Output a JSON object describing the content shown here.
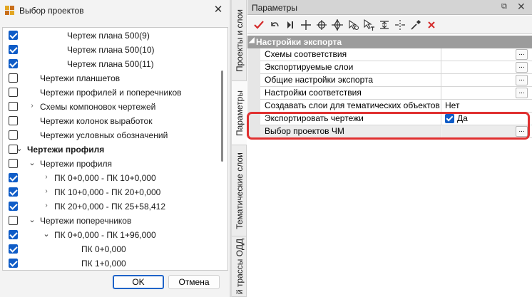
{
  "dialog": {
    "title": "Выбор проектов",
    "close_glyph": "✕",
    "ok_label": "OK",
    "cancel_label": "Отмена",
    "tree": [
      {
        "label": "Чертеж плана 500(9)",
        "checked": true,
        "level": 3,
        "expander": "",
        "bold": false
      },
      {
        "label": "Чертеж плана 500(10)",
        "checked": true,
        "level": 3,
        "expander": "",
        "bold": false
      },
      {
        "label": "Чертеж плана 500(11)",
        "checked": true,
        "level": 3,
        "expander": "",
        "bold": false
      },
      {
        "label": "Чертежи планшетов",
        "checked": false,
        "level": 2,
        "expander": "",
        "bold": false
      },
      {
        "label": "Чертежи профилей и поперечников",
        "checked": false,
        "level": 2,
        "expander": "",
        "bold": false
      },
      {
        "label": "Схемы компоновок чертежей",
        "checked": false,
        "level": 2,
        "expander": "collapsed",
        "bold": false
      },
      {
        "label": "Чертежи колонок выработок",
        "checked": false,
        "level": 2,
        "expander": "",
        "bold": false
      },
      {
        "label": "Чертежи условных обозначений",
        "checked": false,
        "level": 2,
        "expander": "",
        "bold": false
      },
      {
        "label": "Чертежи профиля",
        "checked": false,
        "level": 1,
        "expander": "expanded",
        "bold": true
      },
      {
        "label": "Чертежи профиля",
        "checked": false,
        "level": 2,
        "expander": "expanded",
        "bold": false
      },
      {
        "label": "ПК 0+0,000 - ПК 10+0,000",
        "checked": true,
        "level": 3,
        "expander": "collapsed",
        "bold": false
      },
      {
        "label": "ПК 10+0,000 - ПК 20+0,000",
        "checked": true,
        "level": 3,
        "expander": "collapsed",
        "bold": false
      },
      {
        "label": "ПК 20+0,000 - ПК 25+58,412",
        "checked": true,
        "level": 3,
        "expander": "collapsed",
        "bold": false
      },
      {
        "label": "Чертежи поперечников",
        "checked": false,
        "level": 2,
        "expander": "expanded",
        "bold": false
      },
      {
        "label": "ПК 0+0,000 - ПК 1+96,000",
        "checked": true,
        "level": 3,
        "expander": "expanded",
        "bold": false
      },
      {
        "label": "ПК 0+0,000",
        "checked": true,
        "level": 4,
        "expander": "",
        "bold": false
      },
      {
        "label": "ПК 1+0,000",
        "checked": true,
        "level": 4,
        "expander": "",
        "bold": false
      }
    ]
  },
  "side_tabs": [
    "Проекты и слои",
    "Параметры",
    "Тематические слои",
    "й трассы ОДД"
  ],
  "panel": {
    "title": "Параметры",
    "pin_glyph": "⧉",
    "close_glyph": "✕",
    "toolbar_icons": [
      "check-icon",
      "undo-icon",
      "step-icon",
      "cross-cursor-icon",
      "target-icon",
      "move-target-icon",
      "select-cursor-icon",
      "select-arrow-icon",
      "align-icon",
      "split-icon",
      "pipette-icon",
      "delete-icon"
    ],
    "section": "Настройки экспорта",
    "rows": [
      {
        "name": "Схемы соответствия",
        "value": "",
        "button": "..."
      },
      {
        "name": "Экспортируемые слои",
        "value": "",
        "button": "..."
      },
      {
        "name": "Общие настройки экспорта",
        "value": "",
        "button": "..."
      },
      {
        "name": "Настройки соответствия",
        "value": "",
        "button": "..."
      },
      {
        "name": "Создавать слои для тематических объектов",
        "value": "Нет",
        "button": ""
      },
      {
        "name": "Экспортировать чертежи",
        "value": "Да",
        "button": "",
        "checkbox": true
      },
      {
        "name": "Выбор проектов ЧМ",
        "value": "",
        "button": "..."
      }
    ]
  },
  "colors": {
    "accent": "#0f5cc7",
    "highlight": "#e03030",
    "section_bg": "#9c9c9c"
  }
}
